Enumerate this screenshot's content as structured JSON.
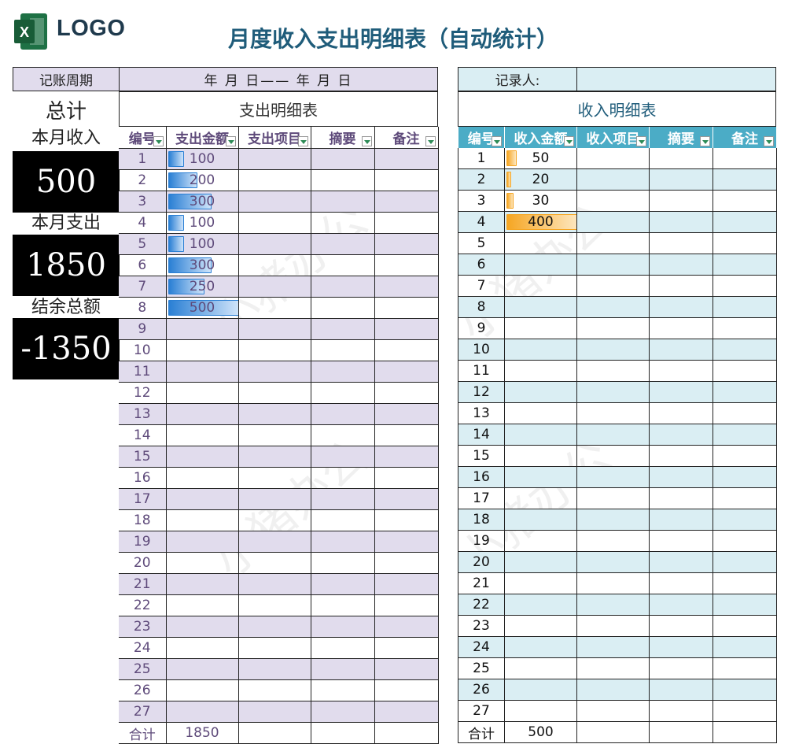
{
  "header": {
    "logo_text": "LOGO",
    "title": "月度收入支出明细表（自动统计）"
  },
  "info": {
    "period_label": "记账周期",
    "period_value": "年  月  日——  年  月  日",
    "recorder_label": "记录人:",
    "recorder_value": ""
  },
  "summary": {
    "title": "总计",
    "income_label": "本月收入",
    "income_value": "500",
    "expense_label": "本月支出",
    "expense_value": "1850",
    "balance_label": "结余总额",
    "balance_value": "-1350"
  },
  "expense": {
    "section_title": "支出明细表",
    "columns": [
      "编号",
      "支出金额",
      "支出项目",
      "摘要",
      "备注"
    ],
    "rows": [
      {
        "no": "1",
        "amount": "100"
      },
      {
        "no": "2",
        "amount": "200"
      },
      {
        "no": "3",
        "amount": "300"
      },
      {
        "no": "4",
        "amount": "100"
      },
      {
        "no": "5",
        "amount": "100"
      },
      {
        "no": "6",
        "amount": "300"
      },
      {
        "no": "7",
        "amount": "250"
      },
      {
        "no": "8",
        "amount": "500"
      },
      {
        "no": "9",
        "amount": ""
      },
      {
        "no": "10",
        "amount": ""
      },
      {
        "no": "11",
        "amount": ""
      },
      {
        "no": "12",
        "amount": ""
      },
      {
        "no": "13",
        "amount": ""
      },
      {
        "no": "14",
        "amount": ""
      },
      {
        "no": "15",
        "amount": ""
      },
      {
        "no": "16",
        "amount": ""
      },
      {
        "no": "17",
        "amount": ""
      },
      {
        "no": "18",
        "amount": ""
      },
      {
        "no": "19",
        "amount": ""
      },
      {
        "no": "20",
        "amount": ""
      },
      {
        "no": "21",
        "amount": ""
      },
      {
        "no": "22",
        "amount": ""
      },
      {
        "no": "23",
        "amount": ""
      },
      {
        "no": "24",
        "amount": ""
      },
      {
        "no": "25",
        "amount": ""
      },
      {
        "no": "26",
        "amount": ""
      },
      {
        "no": "27",
        "amount": ""
      }
    ],
    "total_label": "合计",
    "total_value": "1850",
    "bar_max": 500
  },
  "income": {
    "section_title": "收入明细表",
    "columns": [
      "编号",
      "收入金额",
      "收入项目",
      "摘要",
      "备注"
    ],
    "rows": [
      {
        "no": "1",
        "amount": "50"
      },
      {
        "no": "2",
        "amount": "20"
      },
      {
        "no": "3",
        "amount": "30"
      },
      {
        "no": "4",
        "amount": "400"
      },
      {
        "no": "5",
        "amount": ""
      },
      {
        "no": "6",
        "amount": ""
      },
      {
        "no": "7",
        "amount": ""
      },
      {
        "no": "8",
        "amount": ""
      },
      {
        "no": "9",
        "amount": ""
      },
      {
        "no": "10",
        "amount": ""
      },
      {
        "no": "11",
        "amount": ""
      },
      {
        "no": "12",
        "amount": ""
      },
      {
        "no": "13",
        "amount": ""
      },
      {
        "no": "14",
        "amount": ""
      },
      {
        "no": "15",
        "amount": ""
      },
      {
        "no": "16",
        "amount": ""
      },
      {
        "no": "17",
        "amount": ""
      },
      {
        "no": "18",
        "amount": ""
      },
      {
        "no": "19",
        "amount": ""
      },
      {
        "no": "20",
        "amount": ""
      },
      {
        "no": "21",
        "amount": ""
      },
      {
        "no": "22",
        "amount": ""
      },
      {
        "no": "23",
        "amount": ""
      },
      {
        "no": "24",
        "amount": ""
      },
      {
        "no": "25",
        "amount": ""
      },
      {
        "no": "26",
        "amount": ""
      },
      {
        "no": "27",
        "amount": ""
      }
    ],
    "total_label": "合计",
    "total_value": "500",
    "bar_max": 400
  },
  "watermark": "小猪办公",
  "colors": {
    "expense_band": "#e1dced",
    "income_band": "#daeef3",
    "income_header": "#4bacc6",
    "expense_bar": "#2a7fd4",
    "income_bar": "#f6a623"
  }
}
